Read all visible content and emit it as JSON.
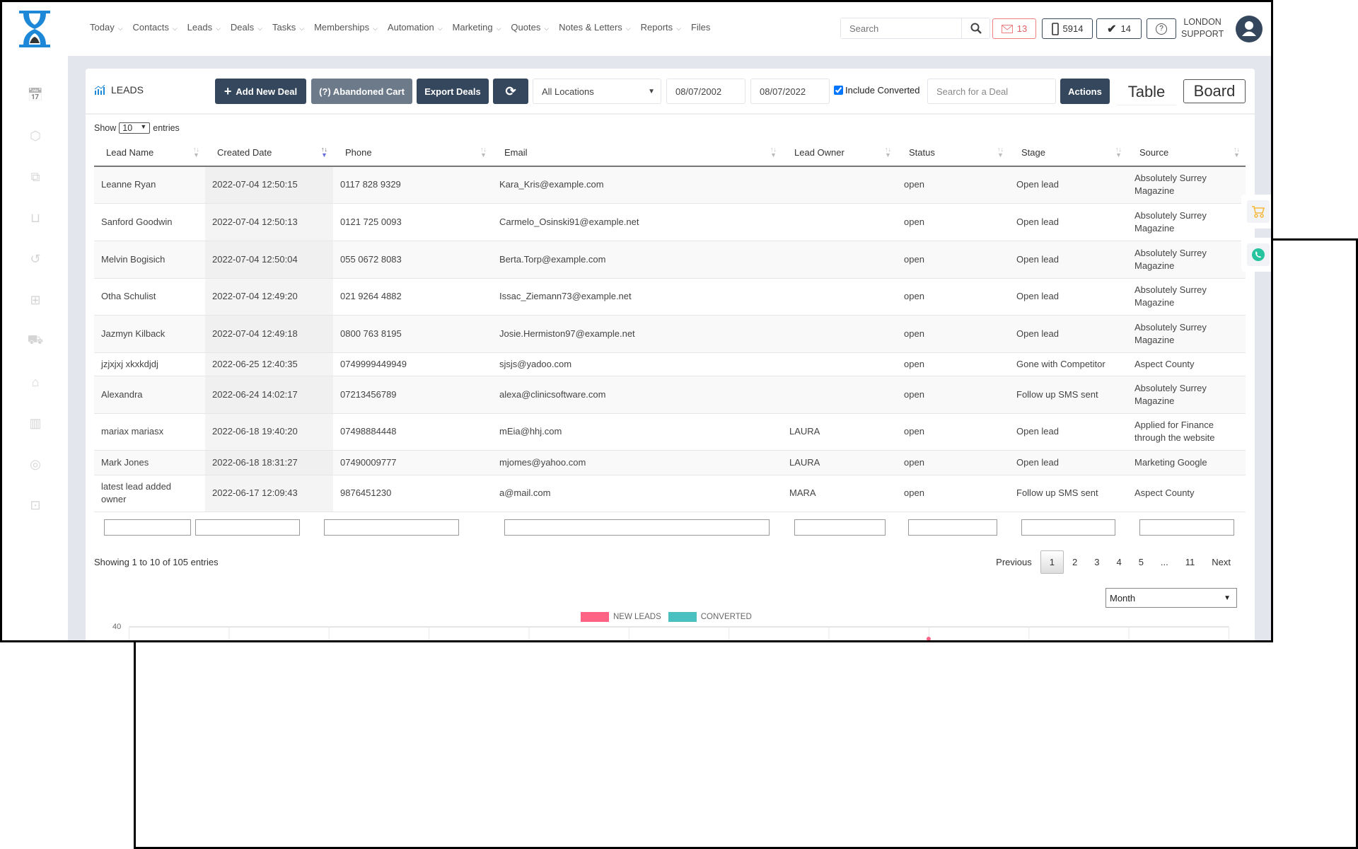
{
  "nav": {
    "menu": [
      "Today",
      "Contacts",
      "Leads",
      "Deals",
      "Tasks",
      "Memberships",
      "Automation",
      "Marketing",
      "Quotes",
      "Notes & Letters",
      "Reports",
      "Files"
    ],
    "menu_has_chevron": [
      true,
      true,
      true,
      true,
      true,
      true,
      true,
      true,
      true,
      true,
      true,
      false
    ],
    "search_placeholder": "Search",
    "mail_count": "13",
    "phone_count": "5914",
    "tasks_count": "14",
    "user_line1": "LONDON",
    "user_line2": "SUPPORT"
  },
  "toolbar": {
    "title": "LEADS",
    "add_new_deal": "Add New Deal",
    "abandoned_cart": "(?) Abandoned Cart",
    "export_deals": "Export Deals",
    "location": "All Locations",
    "date_from": "08/07/2002",
    "date_to": "08/07/2022",
    "include_converted": "Include Converted",
    "include_converted_checked": true,
    "search_deal_placeholder": "Search for a Deal",
    "actions": "Actions",
    "table_view": "Table",
    "board_view": "Board"
  },
  "table": {
    "show_label": "Show",
    "page_size": "10",
    "entries_label": "entries",
    "columns": [
      "Lead Name",
      "Created Date",
      "Phone",
      "Email",
      "Lead Owner",
      "Status",
      "Stage",
      "Source"
    ],
    "sorted_column": "Created Date",
    "rows": [
      [
        "Leanne Ryan",
        "2022-07-04 12:50:15",
        "0117 828 9329",
        "Kara_Kris@example.com",
        "",
        "open",
        "Open lead",
        "Absolutely Surrey Magazine"
      ],
      [
        "Sanford Goodwin",
        "2022-07-04 12:50:13",
        "0121 725 0093",
        "Carmelo_Osinski91@example.net",
        "",
        "open",
        "Open lead",
        "Absolutely Surrey Magazine"
      ],
      [
        "Melvin Bogisich",
        "2022-07-04 12:50:04",
        "055 0672 8083",
        "Berta.Torp@example.com",
        "",
        "open",
        "Open lead",
        "Absolutely Surrey Magazine"
      ],
      [
        "Otha Schulist",
        "2022-07-04 12:49:20",
        "021 9264 4882",
        "Issac_Ziemann73@example.net",
        "",
        "open",
        "Open lead",
        "Absolutely Surrey Magazine"
      ],
      [
        "Jazmyn Kilback",
        "2022-07-04 12:49:18",
        "0800 763 8195",
        "Josie.Hermiston97@example.net",
        "",
        "open",
        "Open lead",
        "Absolutely Surrey Magazine"
      ],
      [
        "jzjxjxj xkxkdjdj",
        "2022-06-25 12:40:35",
        "0749999449949",
        "sjsjs@yadoo.com",
        "",
        "open",
        "Gone with Competitor",
        "Aspect County"
      ],
      [
        "Alexandra",
        "2022-06-24 14:02:17",
        "07213456789",
        "alexa@clinicsoftware.com",
        "",
        "open",
        "Follow up SMS sent",
        "Absolutely Surrey Magazine"
      ],
      [
        "mariax mariasx",
        "2022-06-18 19:40:20",
        "07498884448",
        "mEia@hhj.com",
        "LAURA",
        "open",
        "Open lead",
        "Applied for Finance through the website"
      ],
      [
        "Mark Jones",
        "2022-06-18 18:31:27",
        "07490009777",
        "mjomes@yahoo.com",
        "LAURA",
        "open",
        "Open lead",
        "Marketing Google"
      ],
      [
        "latest lead added owner",
        "2022-06-17 12:09:43",
        "9876451230",
        "a@mail.com",
        "MARA",
        "open",
        "Follow up SMS sent",
        "Aspect County"
      ]
    ],
    "info": "Showing 1 to 10 of 105 entries",
    "pagination": {
      "previous": "Previous",
      "pages": [
        "1",
        "2",
        "3",
        "4",
        "5",
        "...",
        "11"
      ],
      "current": "1",
      "next": "Next"
    }
  },
  "chart": {
    "period": "Month",
    "chart_data": {
      "type": "line",
      "series": [
        {
          "name": "NEW LEADS",
          "color": "#ff6384"
        },
        {
          "name": "CONVERTED",
          "color": "#4bc0c0"
        }
      ],
      "y_ticks": [
        "40"
      ],
      "grid": true,
      "legend": "top"
    }
  },
  "colors": {
    "primary": "#35475d",
    "secondary_btn": "#6c7a89",
    "mail": "#f08080",
    "whatsapp": "#25c39e",
    "cart": "#f5b93b",
    "logo": "#1e88d8"
  }
}
